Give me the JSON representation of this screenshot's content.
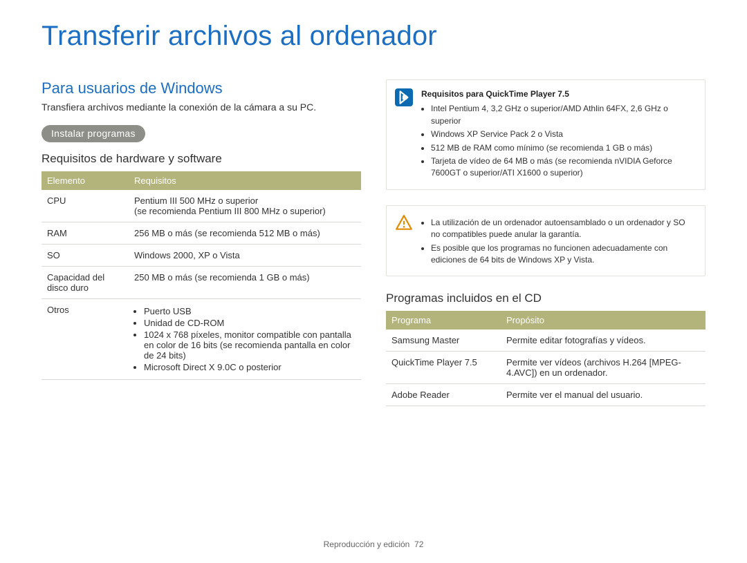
{
  "page": {
    "title": "Transferir archivos al ordenador",
    "footer_label": "Reproducción y edición",
    "footer_page": "72"
  },
  "left": {
    "heading": "Para usuarios de Windows",
    "intro": "Transfiera archivos mediante la conexión de la cámara a su PC.",
    "pill": "Instalar programas",
    "req_heading": "Requisitos de hardware y software",
    "req_table": {
      "headers": {
        "element": "Elemento",
        "req": "Requisitos"
      },
      "rows": {
        "cpu": {
          "label": "CPU",
          "value": "Pentium III 500 MHz o superior\n(se recomienda Pentium III 800 MHz o superior)"
        },
        "ram": {
          "label": "RAM",
          "value": "256 MB o más (se recomienda 512 MB o más)"
        },
        "os": {
          "label": "SO",
          "value": "Windows 2000, XP o Vista"
        },
        "hdd": {
          "label": "Capacidad del disco duro",
          "value": "250 MB o más (se recomienda 1 GB o más)"
        },
        "others": {
          "label": "Otros",
          "items": [
            "Puerto USB",
            "Unidad de CD-ROM",
            "1024 x 768 píxeles, monitor compatible con pantalla en color de 16 bits (se recomienda pantalla en color de 24 bits)",
            "Microsoft Direct X 9.0C o posterior"
          ]
        }
      }
    }
  },
  "right": {
    "qt_box": {
      "title": "Requisitos para QuickTime Player 7.5",
      "items": [
        "Intel Pentium 4, 3,2 GHz o superior/AMD Athlin 64FX, 2,6 GHz o superior",
        "Windows XP Service Pack 2 o Vista",
        "512 MB de RAM como mínimo (se recomienda 1 GB o más)",
        "Tarjeta de vídeo de 64 MB o más (se recomienda nVIDIA Geforce 7600GT o superior/ATI X1600 o superior)"
      ]
    },
    "warn_box": {
      "items": [
        "La utilización de un ordenador autoensamblado o un ordenador y SO no compatibles puede anular la garantía.",
        "Es posible que los programas no funcionen adecuadamente con ediciones de 64 bits de Windows XP y Vista."
      ]
    },
    "prog_heading": "Programas incluidos en el CD",
    "prog_table": {
      "headers": {
        "program": "Programa",
        "purpose": "Propósito"
      },
      "rows": {
        "samsung": {
          "label": "Samsung Master",
          "value": "Permite editar fotografías y vídeos."
        },
        "qt": {
          "label": "QuickTime Player 7.5",
          "value": "Permite ver vídeos (archivos H.264 [MPEG-4.AVC]) en un ordenador."
        },
        "adobe": {
          "label": "Adobe Reader",
          "value": "Permite ver el manual del usuario."
        }
      }
    }
  }
}
